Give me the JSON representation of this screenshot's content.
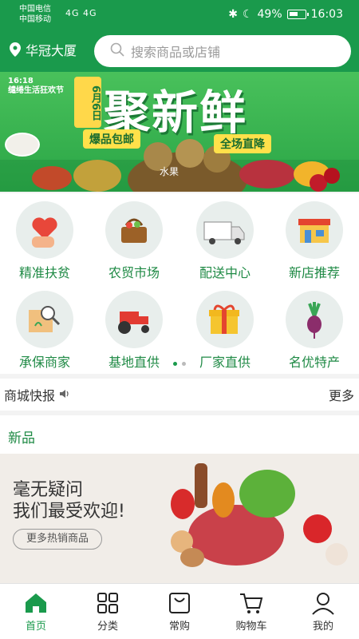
{
  "status_bar": {
    "carrier1": "中国电信",
    "carrier2": "中国移动",
    "signal": "4G 4G",
    "battery": "49%",
    "time": "16:03"
  },
  "header": {
    "location": "华冠大厦",
    "search_placeholder": "搜索商品或店铺"
  },
  "banner": {
    "tag_line1": "16:18",
    "tag_line2": "缱绻生活狂欢节",
    "date": "6月6日",
    "headline": "聚新鲜",
    "promo1": "爆品包邮",
    "promo2": "全场直降",
    "fruit_label": "水果"
  },
  "categories": [
    {
      "label": "精准扶贫",
      "icon": "heart-hand-icon"
    },
    {
      "label": "农贸市场",
      "icon": "basket-icon"
    },
    {
      "label": "配送中心",
      "icon": "truck-icon"
    },
    {
      "label": "新店推荐",
      "icon": "shop-icon"
    },
    {
      "label": "承保商家",
      "icon": "document-search-icon"
    },
    {
      "label": "基地直供",
      "icon": "tractor-icon"
    },
    {
      "label": "厂家直供",
      "icon": "gift-box-icon"
    },
    {
      "label": "名优特产",
      "icon": "radish-icon"
    }
  ],
  "news": {
    "title": "商城快报",
    "more": "更多"
  },
  "new_section": {
    "title": "新品",
    "promo_line1": "毫无疑问",
    "promo_line2": "我们最受欢迎!",
    "promo_button": "更多热销商品"
  },
  "tabs": [
    {
      "label": "首页",
      "icon": "home-icon",
      "active": true
    },
    {
      "label": "分类",
      "icon": "grid-icon",
      "active": false
    },
    {
      "label": "常购",
      "icon": "bag-icon",
      "active": false
    },
    {
      "label": "购物车",
      "icon": "cart-icon",
      "active": false
    },
    {
      "label": "我的",
      "icon": "user-icon",
      "active": false
    }
  ],
  "colors": {
    "brand_green": "#1a9a4c",
    "label_green": "#1f8a45"
  }
}
